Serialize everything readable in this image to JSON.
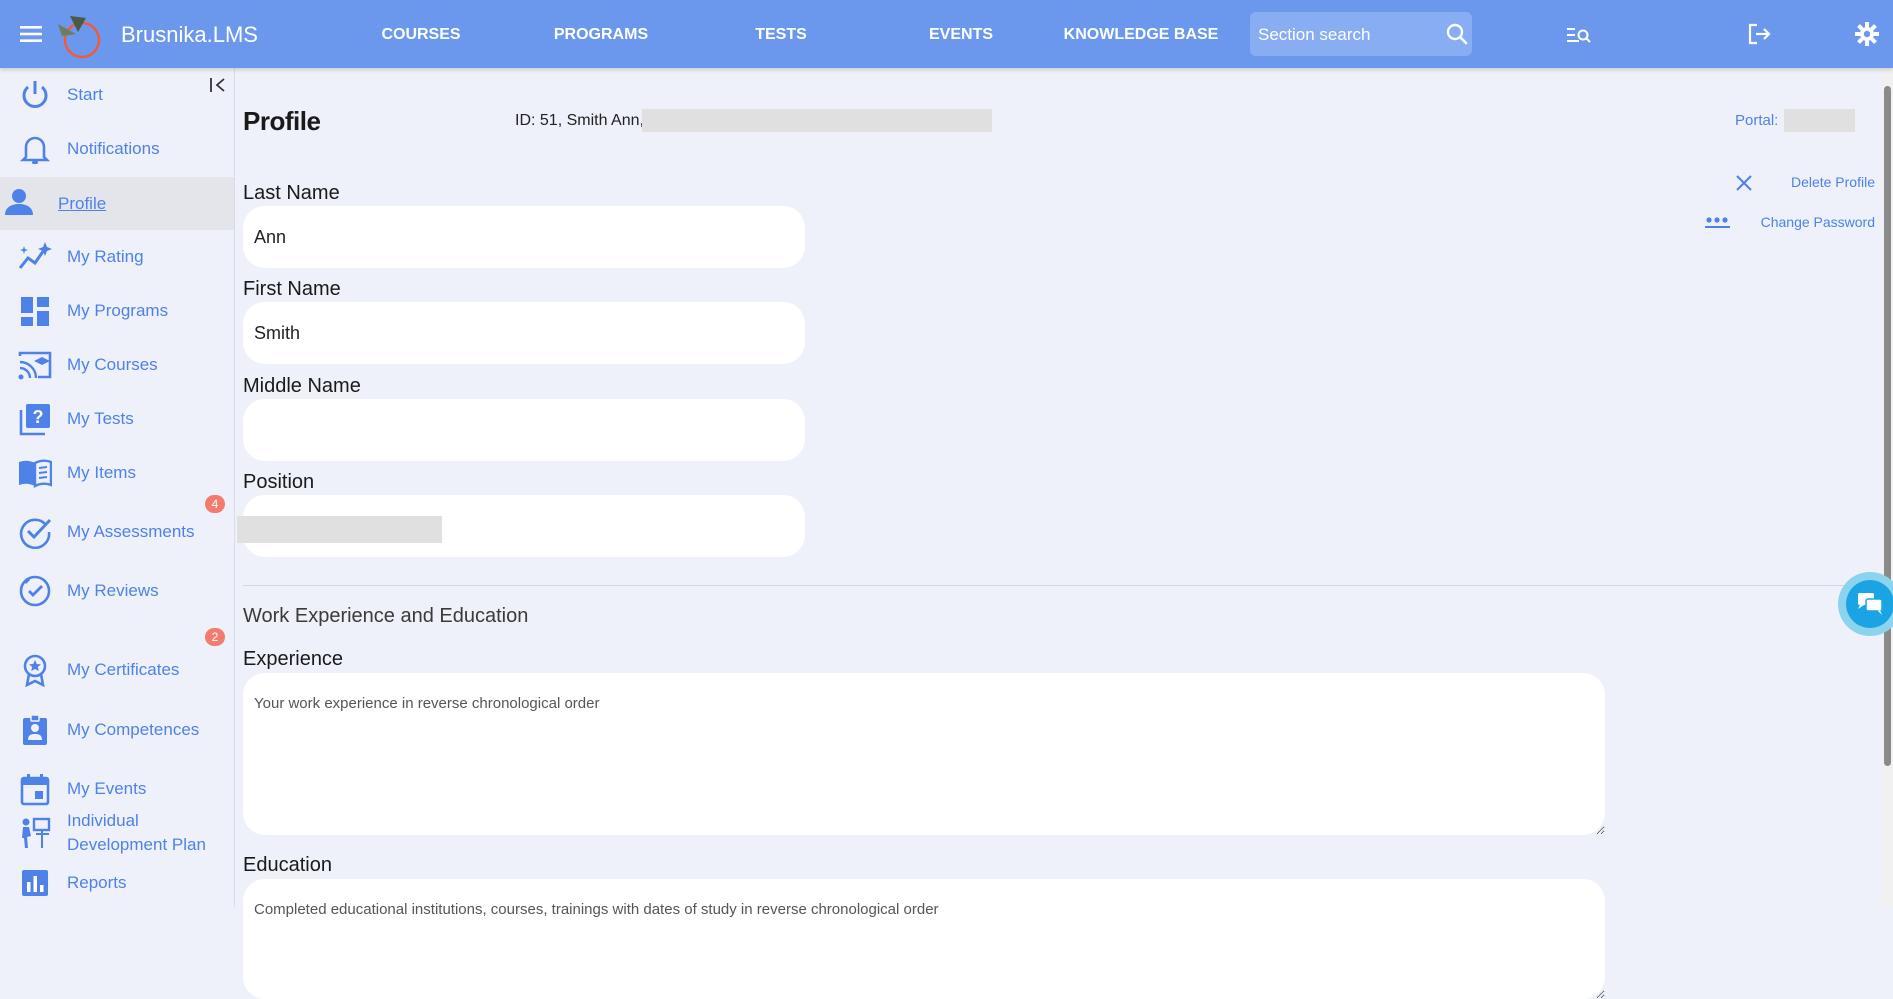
{
  "header": {
    "brand": "Brusnika.LMS",
    "nav": [
      {
        "label": "COURSES"
      },
      {
        "label": "PROGRAMS"
      },
      {
        "label": "TESTS"
      },
      {
        "label": "EVENTS"
      },
      {
        "label": "KNOWLEDGE BASE"
      }
    ],
    "search_placeholder": "Section search",
    "accent_color": "#6b98ed"
  },
  "sidebar": {
    "items": [
      {
        "label": "Start",
        "icon": "power-icon"
      },
      {
        "label": "Notifications",
        "icon": "bell-icon"
      },
      {
        "label": "Profile",
        "icon": "person-icon",
        "active": true
      },
      {
        "label": "My Rating",
        "icon": "rating-chart-icon"
      },
      {
        "label": "My Programs",
        "icon": "dashboard-icon"
      },
      {
        "label": "My Courses",
        "icon": "cast-education-icon"
      },
      {
        "label": "My Tests",
        "icon": "quiz-icon"
      },
      {
        "label": "My Items",
        "icon": "book-icon"
      },
      {
        "label": "My Assessments",
        "icon": "check-circle-icon",
        "badge": "4"
      },
      {
        "label": "My Reviews",
        "icon": "review-icon",
        "badge": "2"
      },
      {
        "label": "My Certificates",
        "icon": "award-icon"
      },
      {
        "label": "My Competences",
        "icon": "badge-person-icon"
      },
      {
        "label": "My Events",
        "icon": "calendar-icon"
      },
      {
        "label": "Individual Development Plan",
        "icon": "development-icon"
      },
      {
        "label": "Reports",
        "icon": "bar-chart-icon"
      }
    ]
  },
  "profile": {
    "title": "Profile",
    "id_line": "ID: 51, Smith Ann, t",
    "portal_label": "Portal: ",
    "actions": {
      "delete": "Delete Profile",
      "change_password": "Change Password"
    },
    "fields": {
      "last_name": {
        "label": "Last Name",
        "value": "Ann"
      },
      "first_name": {
        "label": "First Name",
        "value": "Smith"
      },
      "middle_name": {
        "label": "Middle Name",
        "value": ""
      },
      "position": {
        "label": "Position",
        "value": ""
      }
    },
    "work_section": {
      "title": "Work Experience and Education",
      "experience_label": "Experience",
      "experience_placeholder": "Your work experience in reverse chronological order",
      "education_label": "Education",
      "education_placeholder": "Completed educational institutions, courses, trainings with dates of study in reverse chronological order"
    }
  }
}
